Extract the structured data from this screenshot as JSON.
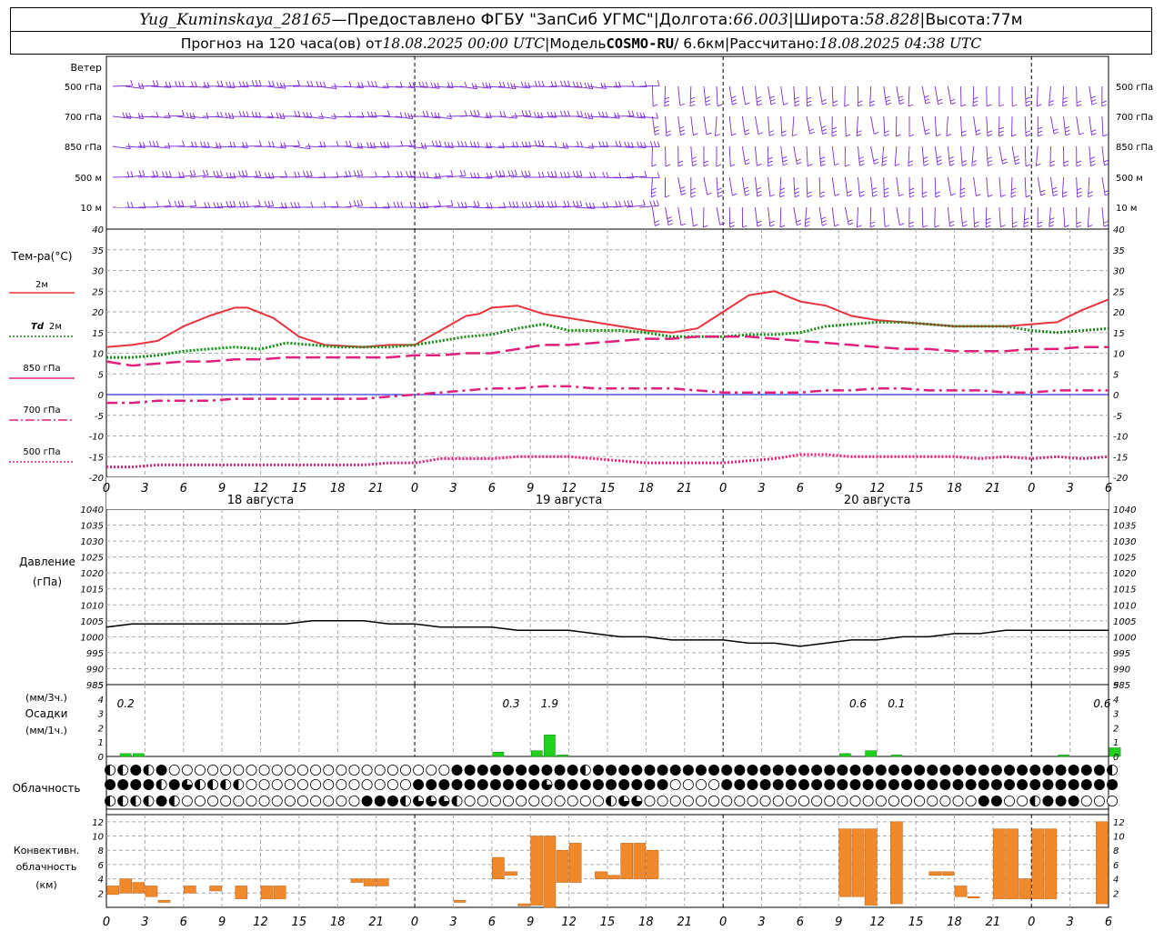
{
  "header": {
    "station": "Yug_Kuminskaya_28165",
    "dash": " — ",
    "provider": "Предоставлено ФГБУ \"ЗапСиб УГМС\"",
    "lon_label": "Долгота: ",
    "lon_value": "66.003",
    "lat_label": "Широта: ",
    "lat_value": "58.828",
    "alt_label": "Высота: ",
    "alt_value": "77м",
    "sep": " | ",
    "forecast_prefix": "Прогноз на 120 часа(ов) от ",
    "forecast_date": "18.08.2025 00:00 UTC",
    "model_label": "Модель ",
    "model_name": "COSMO-RU",
    "model_res": " / 6.6км",
    "computed_label": "Рассчитано: ",
    "computed_date": "18.08.2025 04:38 UTC"
  },
  "labels": {
    "wind_title": "Ветер",
    "wind_levels": [
      "500 гПа",
      "700 гПа",
      "850 гПа",
      "500 м",
      "10 м"
    ],
    "temp_title": "Тем-ра(°С)",
    "legend_2m": "2м",
    "legend_td_sym": "Td",
    "legend_td": "2м",
    "legend_850": "850 гПа",
    "legend_700": "700 гПа",
    "legend_500": "500 гПа",
    "pressure_title": "Давление",
    "pressure_unit": "(гПа)",
    "precip_unit1": "(мм/3ч.)",
    "precip_title": "Осадки",
    "precip_unit2": "(мм/1ч.)",
    "cloud_title": "Облачность",
    "conv_title1": "Конвективн.",
    "conv_title2": "облачность",
    "conv_unit": "(км)",
    "day_labels": [
      "18 августа",
      "19 августа",
      "20 августа"
    ]
  },
  "colors": {
    "t2m": "#e8323c",
    "td2m": "#128c12",
    "t850": "#e0207a",
    "t700": "#e0207a",
    "t500": "#e0207a",
    "wind": "#7a2bd6",
    "precip": "#1ed21e",
    "convective": "#f0882c",
    "pressure": "#000000"
  },
  "chart_data": [
    {
      "type": "line",
      "title": "Тем-ра(°С)",
      "x_unit": "hours since 18.08.2025 00:00 UTC",
      "x_ticks": [
        "0",
        "3",
        "6",
        "9",
        "12",
        "15",
        "18",
        "21",
        "0",
        "3",
        "6",
        "9",
        "12",
        "15",
        "18",
        "21",
        "0",
        "3",
        "6",
        "9",
        "12",
        "15",
        "18",
        "21",
        "0",
        "3",
        "6"
      ],
      "ylim": [
        -20,
        40
      ],
      "series": [
        {
          "name": "2м",
          "x": [
            0,
            2,
            4,
            6,
            8,
            10,
            11,
            13,
            15,
            17,
            20,
            22,
            24,
            26,
            28,
            29,
            30,
            32,
            34,
            36,
            38,
            40,
            42,
            44,
            46,
            48,
            50,
            52,
            54,
            56,
            58,
            60,
            62,
            64,
            66,
            68,
            70,
            72,
            74,
            76,
            78
          ],
          "values": [
            11.5,
            12,
            13,
            16.5,
            19,
            21,
            21,
            18.5,
            14,
            12,
            11.5,
            12,
            12,
            15.5,
            19,
            19.5,
            21,
            21.5,
            19.5,
            18.5,
            17.5,
            16.5,
            15.5,
            15,
            16,
            20,
            24,
            25,
            22.5,
            21.5,
            19,
            18,
            17.5,
            17,
            16.5,
            16.5,
            16.5,
            17,
            17.5,
            20.5,
            23
          ]
        },
        {
          "name": "Td 2м",
          "x": [
            0,
            2,
            4,
            6,
            8,
            10,
            12,
            14,
            16,
            18,
            20,
            22,
            24,
            26,
            28,
            30,
            32,
            34,
            36,
            38,
            40,
            42,
            44,
            46,
            48,
            50,
            52,
            54,
            56,
            58,
            60,
            62,
            64,
            66,
            68,
            70,
            72,
            74,
            76,
            78
          ],
          "values": [
            9,
            9,
            9.5,
            10.5,
            11,
            11.5,
            11,
            12.5,
            12,
            11.5,
            11.5,
            11.5,
            12,
            13,
            14,
            14.5,
            16,
            17,
            15.5,
            15.5,
            15.5,
            15,
            14,
            14,
            14,
            14.5,
            14.5,
            15,
            16.5,
            17,
            17.5,
            17.5,
            17,
            16.5,
            16.5,
            16.5,
            15.5,
            15,
            15.5,
            16
          ]
        },
        {
          "name": "850 гПа",
          "x": [
            0,
            2,
            4,
            6,
            8,
            10,
            12,
            14,
            16,
            18,
            20,
            22,
            24,
            26,
            28,
            30,
            32,
            34,
            36,
            38,
            40,
            42,
            44,
            46,
            48,
            50,
            52,
            54,
            56,
            58,
            60,
            62,
            64,
            66,
            68,
            70,
            72,
            74,
            76,
            78
          ],
          "values": [
            8,
            7,
            7.5,
            8,
            8,
            8.5,
            8.5,
            9,
            9,
            9,
            9,
            9,
            9.5,
            9.5,
            10,
            10,
            11,
            12,
            12,
            12.5,
            13,
            13.5,
            13.5,
            14,
            14,
            14,
            13.5,
            13,
            12.5,
            12,
            11.5,
            11,
            11,
            10.5,
            10.5,
            10.5,
            11,
            11,
            11.5,
            11.5
          ]
        },
        {
          "name": "700 гПа",
          "x": [
            0,
            2,
            4,
            6,
            8,
            10,
            12,
            14,
            16,
            18,
            20,
            22,
            24,
            26,
            28,
            30,
            32,
            34,
            36,
            38,
            40,
            42,
            44,
            46,
            48,
            50,
            52,
            54,
            56,
            58,
            60,
            62,
            64,
            66,
            68,
            70,
            72,
            74,
            76,
            78
          ],
          "values": [
            -2,
            -2,
            -1.5,
            -1.5,
            -1.5,
            -1,
            -1,
            -1,
            -1,
            -1,
            -1,
            -0.5,
            0,
            0.5,
            1,
            1.5,
            1.5,
            2,
            2,
            1.5,
            1.5,
            1.5,
            1.5,
            1,
            0.5,
            0.5,
            0.5,
            0.5,
            1,
            1,
            1.5,
            1.5,
            1,
            1,
            1,
            0.5,
            0.5,
            1,
            1,
            1
          ]
        },
        {
          "name": "500 гПа",
          "x": [
            0,
            2,
            4,
            6,
            8,
            10,
            12,
            14,
            16,
            18,
            20,
            22,
            24,
            26,
            28,
            30,
            32,
            34,
            36,
            38,
            40,
            42,
            44,
            46,
            48,
            50,
            52,
            54,
            56,
            58,
            60,
            62,
            64,
            66,
            68,
            70,
            72,
            74,
            76,
            78
          ],
          "values": [
            -17.5,
            -17.5,
            -17,
            -17,
            -17,
            -17,
            -17,
            -17,
            -17,
            -17,
            -17,
            -16.5,
            -16.5,
            -15.5,
            -15.5,
            -15.5,
            -15,
            -15,
            -15,
            -15.5,
            -16,
            -16.5,
            -16.5,
            -16.5,
            -16.5,
            -16,
            -15.5,
            -14.5,
            -14.5,
            -15,
            -15,
            -15,
            -15,
            -15,
            -15.5,
            -15,
            -15.5,
            -15,
            -15.5,
            -15
          ]
        }
      ]
    },
    {
      "type": "line",
      "title": "Давление (гПа)",
      "ylim": [
        985,
        1040
      ],
      "series": [
        {
          "name": "Давление",
          "x": [
            0,
            2,
            4,
            6,
            8,
            10,
            12,
            14,
            16,
            18,
            20,
            22,
            24,
            26,
            28,
            30,
            32,
            34,
            36,
            38,
            40,
            42,
            44,
            46,
            48,
            50,
            52,
            54,
            56,
            58,
            60,
            62,
            64,
            66,
            68,
            70,
            72,
            74,
            76,
            78
          ],
          "values": [
            1003,
            1004,
            1004,
            1004,
            1004,
            1004,
            1004,
            1004,
            1005,
            1005,
            1005,
            1004,
            1004,
            1003,
            1003,
            1003,
            1002,
            1002,
            1002,
            1001,
            1000,
            1000,
            999,
            999,
            999,
            998,
            998,
            997,
            998,
            999,
            999,
            1000,
            1000,
            1001,
            1001,
            1002,
            1002,
            1002,
            1002,
            1002
          ]
        }
      ]
    },
    {
      "type": "bar",
      "title": "Осадки (мм/1ч.)",
      "ylim": [
        0,
        5
      ],
      "x": [
        1,
        2,
        30,
        33,
        34,
        35,
        57,
        59,
        61,
        74,
        78
      ],
      "values": [
        0.2,
        0.2,
        0.3,
        0.4,
        1.5,
        0.1,
        0.2,
        0.4,
        0.1,
        0.1,
        0.6
      ],
      "annotations": [
        {
          "x": 1.5,
          "label": "0.2"
        },
        {
          "x": 31.5,
          "label": "0.3"
        },
        {
          "x": 34.5,
          "label": "1.9"
        },
        {
          "x": 58.5,
          "label": "0.6"
        },
        {
          "x": 61.5,
          "label": "0.1"
        },
        {
          "x": 77.5,
          "label": "0.6"
        }
      ]
    },
    {
      "type": "bar",
      "title": "Конвективн. облачность (км)",
      "ylim": [
        0,
        12
      ],
      "bars": [
        {
          "x": 0.5,
          "base": 1.8,
          "top": 3
        },
        {
          "x": 1.5,
          "base": 2,
          "top": 4
        },
        {
          "x": 2.5,
          "base": 2,
          "top": 3.5
        },
        {
          "x": 3.5,
          "base": 1.5,
          "top": 3
        },
        {
          "x": 4.5,
          "base": 0.7,
          "top": 1
        },
        {
          "x": 6.5,
          "base": 2,
          "top": 3
        },
        {
          "x": 8.5,
          "base": 2.3,
          "top": 3
        },
        {
          "x": 10.5,
          "base": 1.2,
          "top": 3
        },
        {
          "x": 12.5,
          "base": 1.2,
          "top": 3
        },
        {
          "x": 13.5,
          "base": 1.2,
          "top": 3
        },
        {
          "x": 19.5,
          "base": 3.5,
          "top": 4
        },
        {
          "x": 20.5,
          "base": 3,
          "top": 4
        },
        {
          "x": 21.5,
          "base": 3,
          "top": 4
        },
        {
          "x": 27.5,
          "base": 0.7,
          "top": 1
        },
        {
          "x": 30.5,
          "base": 4,
          "top": 7
        },
        {
          "x": 31.5,
          "base": 4.5,
          "top": 5
        },
        {
          "x": 32.5,
          "base": 0.2,
          "top": 0.5
        },
        {
          "x": 33.5,
          "base": 0.3,
          "top": 10
        },
        {
          "x": 34.5,
          "base": 0,
          "top": 10
        },
        {
          "x": 35.5,
          "base": 3.5,
          "top": 8
        },
        {
          "x": 36.5,
          "base": 3.5,
          "top": 9
        },
        {
          "x": 38.5,
          "base": 4,
          "top": 5
        },
        {
          "x": 39.5,
          "base": 4,
          "top": 4.5
        },
        {
          "x": 40.5,
          "base": 4,
          "top": 9
        },
        {
          "x": 41.5,
          "base": 4,
          "top": 9
        },
        {
          "x": 42.5,
          "base": 4,
          "top": 8
        },
        {
          "x": 57.5,
          "base": 1.5,
          "top": 11
        },
        {
          "x": 58.5,
          "base": 1.5,
          "top": 11
        },
        {
          "x": 59.5,
          "base": 0.3,
          "top": 11
        },
        {
          "x": 61.5,
          "base": 0.5,
          "top": 12
        },
        {
          "x": 64.5,
          "base": 4.5,
          "top": 5
        },
        {
          "x": 65.5,
          "base": 4.5,
          "top": 5
        },
        {
          "x": 66.5,
          "base": 1.5,
          "top": 3
        },
        {
          "x": 67.5,
          "base": 1.3,
          "top": 1.5
        },
        {
          "x": 69.5,
          "base": 1.2,
          "top": 11
        },
        {
          "x": 70.5,
          "base": 1.2,
          "top": 11
        },
        {
          "x": 71.5,
          "base": 1.2,
          "top": 4
        },
        {
          "x": 72.5,
          "base": 1.2,
          "top": 11
        },
        {
          "x": 73.5,
          "base": 1.2,
          "top": 11
        },
        {
          "x": 77.5,
          "base": 0.5,
          "top": 12
        }
      ]
    }
  ]
}
